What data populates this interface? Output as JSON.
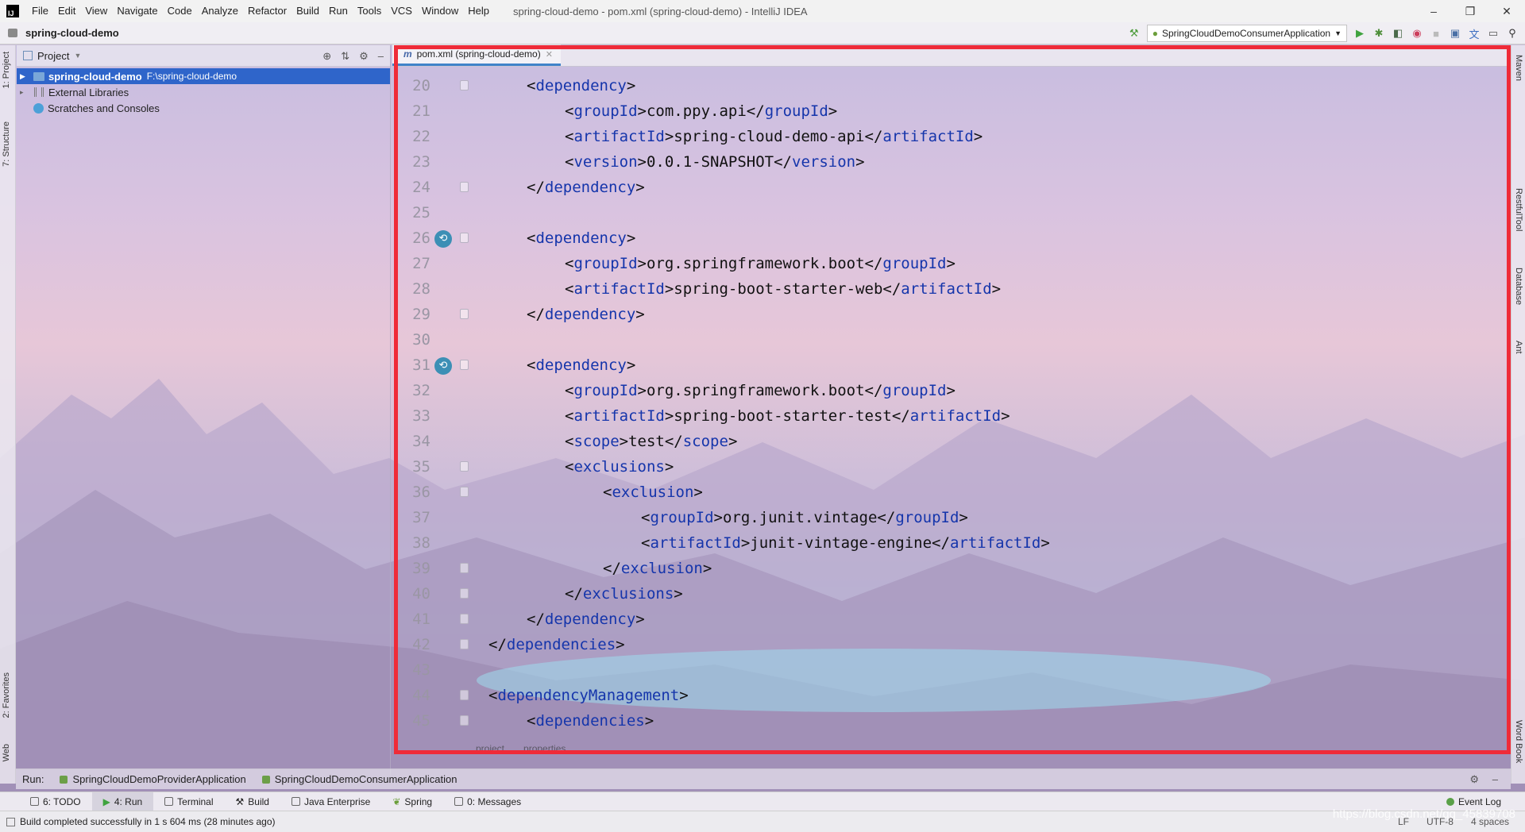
{
  "window": {
    "title": "spring-cloud-demo - pom.xml (spring-cloud-demo) - IntelliJ IDEA",
    "controls": [
      "–",
      "❐",
      "✕"
    ]
  },
  "menu": [
    "File",
    "Edit",
    "View",
    "Navigate",
    "Code",
    "Analyze",
    "Refactor",
    "Build",
    "Run",
    "Tools",
    "VCS",
    "Window",
    "Help"
  ],
  "navbar": {
    "breadcrumb": "spring-cloud-demo",
    "run_config": "SpringCloudDemoConsumerApplication"
  },
  "left_tool_tabs": [
    "1: Project",
    "7: Structure",
    "2: Favorites",
    "Web"
  ],
  "right_tool_tabs": [
    "Maven",
    "RestfulTool",
    "Database",
    "Ant",
    "Word Book"
  ],
  "project_panel": {
    "title": "Project",
    "tree": [
      {
        "label": "spring-cloud-demo",
        "path": "F:\\spring-cloud-demo",
        "selected": true
      },
      {
        "label": "External Libraries",
        "path": ""
      },
      {
        "label": "Scratches and Consoles",
        "path": ""
      }
    ]
  },
  "editor": {
    "tab_label": "pom.xml (spring-cloud-demo)",
    "tab_icon": "m",
    "lines": [
      {
        "n": "20",
        "indent": 2,
        "parts": [
          "<",
          "dependency",
          ">"
        ]
      },
      {
        "n": "21",
        "indent": 3,
        "parts": [
          "<",
          "groupId",
          ">com.ppy.api</",
          "groupId",
          ">"
        ]
      },
      {
        "n": "22",
        "indent": 3,
        "parts": [
          "<",
          "artifactId",
          ">spring-cloud-demo-api</",
          "artifactId",
          ">"
        ]
      },
      {
        "n": "23",
        "indent": 3,
        "parts": [
          "<",
          "version",
          ">0.0.1-SNAPSHOT</",
          "version",
          ">"
        ]
      },
      {
        "n": "24",
        "indent": 2,
        "parts": [
          "</",
          "dependency",
          ">"
        ]
      },
      {
        "n": "25",
        "indent": 0,
        "parts": []
      },
      {
        "n": "26",
        "indent": 2,
        "parts": [
          "<",
          "dependency",
          ">"
        ],
        "icon": true
      },
      {
        "n": "27",
        "indent": 3,
        "parts": [
          "<",
          "groupId",
          ">org.springframework.boot</",
          "groupId",
          ">"
        ]
      },
      {
        "n": "28",
        "indent": 3,
        "parts": [
          "<",
          "artifactId",
          ">spring-boot-starter-web</",
          "artifactId",
          ">"
        ]
      },
      {
        "n": "29",
        "indent": 2,
        "parts": [
          "</",
          "dependency",
          ">"
        ]
      },
      {
        "n": "30",
        "indent": 0,
        "parts": []
      },
      {
        "n": "31",
        "indent": 2,
        "parts": [
          "<",
          "dependency",
          ">"
        ],
        "icon": true
      },
      {
        "n": "32",
        "indent": 3,
        "parts": [
          "<",
          "groupId",
          ">org.springframework.boot</",
          "groupId",
          ">"
        ]
      },
      {
        "n": "33",
        "indent": 3,
        "parts": [
          "<",
          "artifactId",
          ">spring-boot-starter-test</",
          "artifactId",
          ">"
        ]
      },
      {
        "n": "34",
        "indent": 3,
        "parts": [
          "<",
          "scope",
          ">test</",
          "scope",
          ">"
        ]
      },
      {
        "n": "35",
        "indent": 3,
        "parts": [
          "<",
          "exclusions",
          ">"
        ]
      },
      {
        "n": "36",
        "indent": 4,
        "parts": [
          "<",
          "exclusion",
          ">"
        ]
      },
      {
        "n": "37",
        "indent": 5,
        "parts": [
          "<",
          "groupId",
          ">org.junit.vintage</",
          "groupId",
          ">"
        ]
      },
      {
        "n": "38",
        "indent": 5,
        "parts": [
          "<",
          "artifactId",
          ">junit-vintage-engine</",
          "artifactId",
          ">"
        ]
      },
      {
        "n": "39",
        "indent": 4,
        "parts": [
          "</",
          "exclusion",
          ">"
        ]
      },
      {
        "n": "40",
        "indent": 3,
        "parts": [
          "</",
          "exclusions",
          ">"
        ]
      },
      {
        "n": "41",
        "indent": 2,
        "parts": [
          "</",
          "dependency",
          ">"
        ]
      },
      {
        "n": "42",
        "indent": 1,
        "parts": [
          "</",
          "dependencies",
          ">"
        ]
      },
      {
        "n": "43",
        "indent": 0,
        "parts": []
      },
      {
        "n": "44",
        "indent": 1,
        "parts": [
          "<",
          "dependencyManagement",
          ">"
        ]
      },
      {
        "n": "45",
        "indent": 2,
        "parts": [
          "<",
          "dependencies",
          ">"
        ]
      }
    ],
    "breadcrumbs": [
      "project",
      "properties"
    ]
  },
  "run_panel": {
    "label": "Run:",
    "tabs": [
      "SpringCloudDemoProviderApplication",
      "SpringCloudDemoConsumerApplication"
    ]
  },
  "bottom_tabs": [
    {
      "label": "6: TODO",
      "active": false
    },
    {
      "label": "4: Run",
      "active": true
    },
    {
      "label": "Terminal",
      "active": false
    },
    {
      "label": "Build",
      "active": false
    },
    {
      "label": "Java Enterprise",
      "active": false
    },
    {
      "label": "Spring",
      "active": false
    },
    {
      "label": "0: Messages",
      "active": false
    }
  ],
  "event_log": "Event Log",
  "status": {
    "message": "Build completed successfully in 1 s 604 ms (28 minutes ago)",
    "right": [
      "LF",
      "UTF-8",
      "4 spaces"
    ]
  },
  "watermark": "https://blog.csdn.net/qq_45839708",
  "colors": {
    "accent": "#2f65ca",
    "xml_tag": "#1535ab",
    "highlight_border": "#ef2b38",
    "line_number": "#9a96a4"
  }
}
